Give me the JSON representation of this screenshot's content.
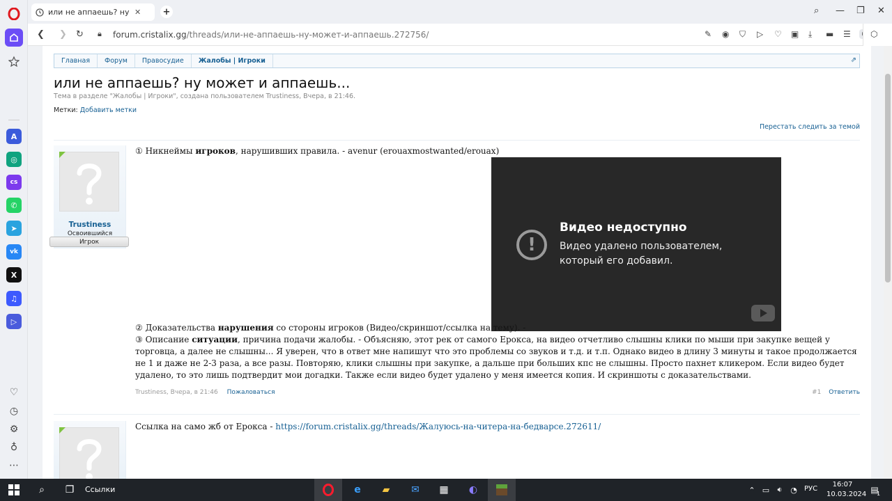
{
  "browser": {
    "tab_title": "или не аппаешь? ну мож",
    "tab_close": "✕",
    "new_tab": "+",
    "url_host": "forum.cristalix.gg",
    "url_path": "/threads/или-не-аппаешь-ну-может-и-аппаешь.272756/"
  },
  "sidebar": {
    "apps": [
      {
        "name": "aria",
        "color": "#3b5bdb",
        "glyph": "A"
      },
      {
        "name": "chatgpt",
        "color": "#10a37f",
        "glyph": "◎"
      },
      {
        "name": "chatsonic",
        "color": "#7c3aed",
        "glyph": "cs"
      },
      {
        "name": "whatsapp",
        "color": "#25d366",
        "glyph": "✆"
      },
      {
        "name": "telegram",
        "color": "#2aa3df",
        "glyph": "➤"
      },
      {
        "name": "vk",
        "color": "#2787f5",
        "glyph": "vk"
      },
      {
        "name": "x",
        "color": "#111111",
        "glyph": "𝕏"
      },
      {
        "name": "music",
        "color": "#3d5afe",
        "glyph": "♫"
      },
      {
        "name": "player",
        "color": "#4a5bdc",
        "glyph": "▷"
      }
    ]
  },
  "forum": {
    "breadcrumbs": [
      "Главная",
      "Форум",
      "Правосудие",
      "Жалобы | Игроки"
    ],
    "title": "или не аппаешь? ну может и аппаешь...",
    "description": "Тема в разделе \"Жалобы | Игроки\", создана пользователем Trustiness, Вчера, в 21:46.",
    "tags_label": "Метки:",
    "tags_add": "Добавить метки",
    "unwatch": "Перестать следить за темой",
    "post1": {
      "user": "Trustiness",
      "user_title": "Освоившийся",
      "user_banner": "Игрок",
      "line1_prefix": "① Никнеймы ",
      "line1_bold": "игроков",
      "line1_suffix": ", нарушивших правила. - avenur (erouaxmostwanted/erouax)",
      "line2_prefix": "② Доказательства ",
      "line2_bold": "нарушения",
      "line2_suffix": " со стороны игроков (Видео/скриншот/ссылка на тему). -",
      "line3_prefix": "③ Описание ",
      "line3_bold": "ситуации",
      "line3_suffix": ", причина подачи жалобы. - Объясняю, этот рек от самого Ерокса, на видео отчетливо слышны клики по мыши при закупке вещей у торговца, а далее не слышны... Я уверен, что в ответ мне напишут что это проблемы со звуков и т.д. и т.п. Однако видео в длину 3 минуты и такое продолжается не 1 и даже не 2-3 раза, а все разы. Повторяю, клики слышны при закупке, а дальше при больших кпс не слышны. Просто пахнет кликером. Если видео будет удалено, то это лишь подтвердит мои догадки. Также если видео будет удалено у меня имеется копия. И скриншоты с доказательствами.",
      "video_title": "Видео недоступно",
      "video_text": "Видео удалено пользователем, который его добавил.",
      "meta_author": "Trustiness",
      "meta_date": "Вчера, в 21:46",
      "report": "Пожаловаться",
      "number": "#1",
      "reply": "Ответить"
    },
    "post2": {
      "text_prefix": "Ссылка на само жб от Ерокса - ",
      "link": "https://forum.cristalix.gg/threads/Жалуюсь-на-читера-на-бедварсе.272611/"
    }
  },
  "taskbar": {
    "search_label": "Ссылки",
    "lang": "РУС",
    "time": "16:07",
    "date": "10.03.2024",
    "notif_count": "1"
  }
}
